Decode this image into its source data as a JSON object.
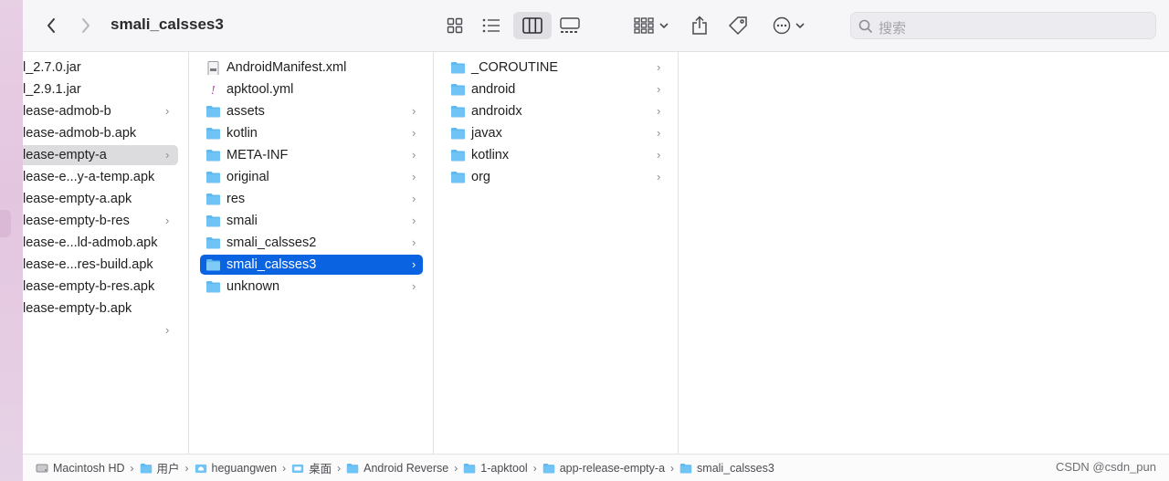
{
  "window": {
    "title": "smali_calsses3"
  },
  "toolbar": {
    "search_placeholder": "搜索",
    "icons": [
      "chevron-left-icon",
      "chevron-right-icon",
      "icon-view-icon",
      "list-view-icon",
      "column-view-icon",
      "gallery-view-icon",
      "group-icon",
      "share-icon",
      "tag-icon",
      "more-icon",
      "search-icon"
    ]
  },
  "column1": {
    "items": [
      {
        "label": "l_2.7.0.jar",
        "type": "file",
        "chevron": false
      },
      {
        "label": "l_2.9.1.jar",
        "type": "file",
        "chevron": false
      },
      {
        "label": "lease-admob-b",
        "type": "folder",
        "chevron": true
      },
      {
        "label": "lease-admob-b.apk",
        "type": "file",
        "chevron": false
      },
      {
        "label": "lease-empty-a",
        "type": "folder",
        "chevron": true,
        "selected": true
      },
      {
        "label": "lease-e...y-a-temp.apk",
        "type": "file",
        "chevron": false
      },
      {
        "label": "lease-empty-a.apk",
        "type": "file",
        "chevron": false
      },
      {
        "label": "lease-empty-b-res",
        "type": "folder",
        "chevron": true
      },
      {
        "label": "lease-e...ld-admob.apk",
        "type": "file",
        "chevron": false
      },
      {
        "label": "lease-e...res-build.apk",
        "type": "file",
        "chevron": false
      },
      {
        "label": "lease-empty-b-res.apk",
        "type": "file",
        "chevron": false
      },
      {
        "label": "lease-empty-b.apk",
        "type": "file",
        "chevron": false
      },
      {
        "label": "",
        "type": "folder",
        "chevron": true
      }
    ]
  },
  "column2": {
    "items": [
      {
        "label": "AndroidManifest.xml",
        "type": "xml"
      },
      {
        "label": "apktool.yml",
        "type": "yml"
      },
      {
        "label": "assets",
        "type": "folder"
      },
      {
        "label": "kotlin",
        "type": "folder"
      },
      {
        "label": "META-INF",
        "type": "folder"
      },
      {
        "label": "original",
        "type": "folder"
      },
      {
        "label": "res",
        "type": "folder"
      },
      {
        "label": "smali",
        "type": "folder"
      },
      {
        "label": "smali_calsses2",
        "type": "folder"
      },
      {
        "label": "smali_calsses3",
        "type": "folder",
        "selected": true
      },
      {
        "label": "unknown",
        "type": "folder"
      }
    ]
  },
  "column3": {
    "items": [
      {
        "label": "_COROUTINE",
        "type": "folder"
      },
      {
        "label": "android",
        "type": "folder"
      },
      {
        "label": "androidx",
        "type": "folder"
      },
      {
        "label": "javax",
        "type": "folder"
      },
      {
        "label": "kotlinx",
        "type": "folder"
      },
      {
        "label": "org",
        "type": "folder"
      }
    ]
  },
  "pathbar": {
    "items": [
      {
        "label": "Macintosh HD",
        "icon": "disk-icon"
      },
      {
        "label": "用户",
        "icon": "folder-icon"
      },
      {
        "label": "heguangwen",
        "icon": "home-icon"
      },
      {
        "label": "桌面",
        "icon": "desktop-folder-icon"
      },
      {
        "label": "Android Reverse",
        "icon": "folder-icon"
      },
      {
        "label": "1-apktool",
        "icon": "folder-icon"
      },
      {
        "label": "app-release-empty-a",
        "icon": "folder-icon"
      },
      {
        "label": "smali_calsses3",
        "icon": "folder-icon"
      }
    ]
  },
  "watermark": "CSDN @csdn_pun",
  "colors": {
    "selection": "#0a63e0",
    "folder": "#5fb8f0"
  }
}
